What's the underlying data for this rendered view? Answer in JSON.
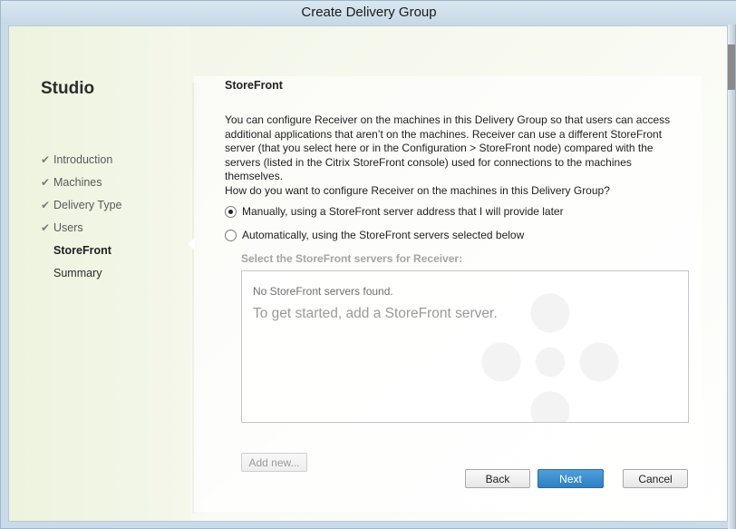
{
  "window": {
    "title": "Create Delivery Group"
  },
  "sidebar": {
    "heading": "Studio",
    "steps": [
      {
        "label": "Introduction",
        "state": "done"
      },
      {
        "label": "Machines",
        "state": "done"
      },
      {
        "label": "Delivery Type",
        "state": "done"
      },
      {
        "label": "Users",
        "state": "done"
      },
      {
        "label": "StoreFront",
        "state": "active"
      },
      {
        "label": "Summary",
        "state": "pending"
      }
    ],
    "check_glyph": "✔"
  },
  "main": {
    "title": "StoreFront",
    "description": "You can configure Receiver on the machines in this Delivery Group so that users can access additional applications that aren’t on the machines. Receiver can use a different StoreFront server (that you select here or in the Configuration > StoreFront node) compared with the servers (listed in the Citrix StoreFront console) used for connections to the machines themselves.",
    "question": "How do you want to configure Receiver on the machines in this Delivery Group?",
    "options": [
      {
        "label": "Manually, using a StoreFront server address that I will provide later",
        "selected": true
      },
      {
        "label": "Automatically, using the StoreFront servers selected below",
        "selected": false
      }
    ],
    "servers_label": "Select the StoreFront servers for Receiver:",
    "empty_message": "No StoreFront servers found.",
    "empty_hint": "To get started, add a StoreFront server.",
    "add_new_label": "Add new..."
  },
  "footer": {
    "back_label": "Back",
    "next_label": "Next",
    "cancel_label": "Cancel"
  },
  "colors": {
    "accent": "#2f7fc4",
    "sidebar_bg": "#eef3df"
  }
}
